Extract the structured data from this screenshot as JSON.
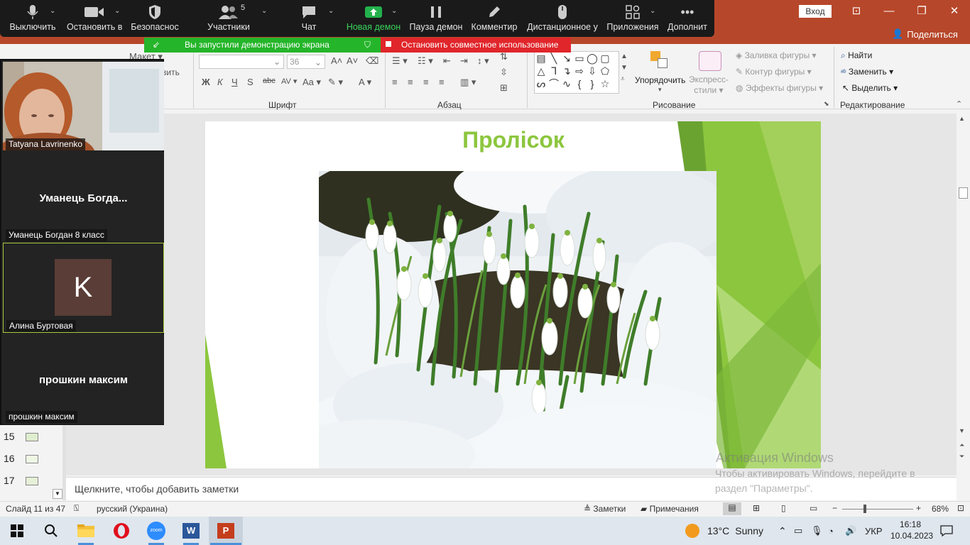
{
  "ppt": {
    "login_label": "Вход",
    "share_label": "Поделиться",
    "ribbon": {
      "groups": [
        "Шрифт",
        "Абзац",
        "Рисование",
        "Редактирование"
      ],
      "layout_label": "Макет",
      "partial_label": "вить",
      "font_size": "36",
      "arrange_label": "Упорядочить",
      "styles_label_1": "Экспресс-",
      "styles_label_2": "стили",
      "fill_label": "Заливка фигуры",
      "outline_label": "Контур фигуры",
      "effects_label": "Эффекты фигуры",
      "find_label": "Найти",
      "replace_label": "Заменить",
      "select_label": "Выделить"
    },
    "slide": {
      "title": "Пролісок"
    },
    "thumbnails": [
      "15",
      "16",
      "17"
    ],
    "notes_placeholder": "Щелкните, чтобы добавить заметки",
    "watermark": {
      "title": "Активация Windows",
      "text": "Чтобы активировать Windows, перейдите в раздел \"Параметры\"."
    },
    "status": {
      "slide_info": "Слайд 11 из 47",
      "language": "русский (Украина)",
      "notes_btn": "Заметки",
      "comments_btn": "Примечания",
      "zoom": "68%"
    }
  },
  "zoom": {
    "toolbar": [
      {
        "id": "mute",
        "label": "Выключить",
        "icon": "microphone-icon"
      },
      {
        "id": "video",
        "label": "Остановить в",
        "icon": "video-camera-icon"
      },
      {
        "id": "security",
        "label": "Безопаснос",
        "icon": "shield-icon"
      },
      {
        "id": "participants",
        "label": "Участники",
        "icon": "participants-icon",
        "count": "5"
      },
      {
        "id": "chat",
        "label": "Чат",
        "icon": "chat-icon"
      },
      {
        "id": "new_share",
        "label": "Новая демон",
        "icon": "share-screen-icon"
      },
      {
        "id": "pause_share",
        "label": "Пауза демон",
        "icon": "pause-icon"
      },
      {
        "id": "annotate",
        "label": "Комментир",
        "icon": "pencil-icon"
      },
      {
        "id": "remote",
        "label": "Дистанционное у",
        "icon": "mouse-icon"
      },
      {
        "id": "apps",
        "label": "Приложения",
        "icon": "apps-icon"
      },
      {
        "id": "more",
        "label": "Дополнит",
        "icon": "more-icon"
      }
    ],
    "share_banner": "Вы запустили демонстрацию экрана",
    "stop_banner": "Остановить совместное использование",
    "participants": [
      {
        "name": "Tatyana Lavrinenko",
        "type": "video"
      },
      {
        "name": "Уманець Богдан 8 класс",
        "display": "Уманець Богда...",
        "type": "name"
      },
      {
        "name": "Алина Буртовая",
        "initial": "K",
        "avatar_color": "#5a3d36",
        "type": "avatar"
      },
      {
        "name": "прошкин максим",
        "display": "прошкин максим",
        "type": "name"
      }
    ]
  },
  "taskbar": {
    "weather_temp": "13°C",
    "weather_text": "Sunny",
    "language": "УКР",
    "time": "16:18",
    "date": "10.04.2023",
    "apps": [
      "file-explorer-icon",
      "opera-icon",
      "zoom-icon",
      "word-icon",
      "powerpoint-icon"
    ],
    "zoom_app_label": "zoom"
  },
  "colors": {
    "ppt_accent": "#b7472a",
    "title_green": "#8cc63e",
    "share_green": "#25b52a",
    "stop_red": "#e0262b"
  }
}
